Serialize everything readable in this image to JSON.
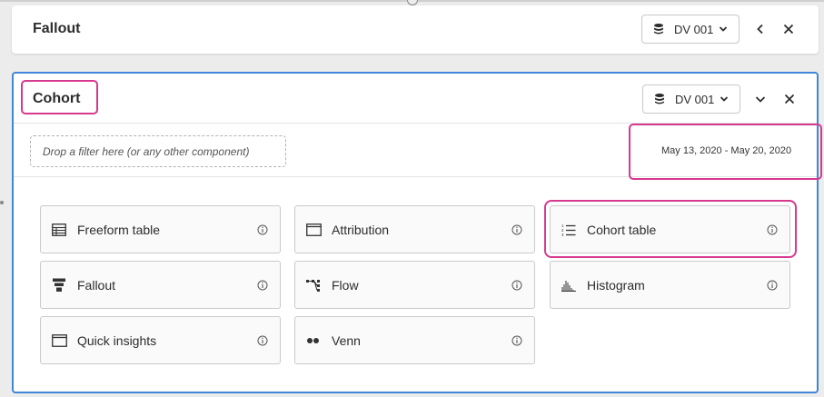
{
  "panels": {
    "fallout": {
      "title": "Fallout",
      "datasource_label": "DV 001"
    },
    "cohort": {
      "title": "Cohort",
      "datasource_label": "DV 001",
      "filter_placeholder": "Drop a filter here (or any other component)",
      "date_range": "May 13, 2020 - May 20, 2020"
    }
  },
  "visualizations": [
    {
      "label": "Freeform table",
      "icon": "table-icon"
    },
    {
      "label": "Attribution",
      "icon": "window-icon"
    },
    {
      "label": "Cohort table",
      "icon": "numbered-list-icon"
    },
    {
      "label": "Fallout",
      "icon": "funnel-icon"
    },
    {
      "label": "Flow",
      "icon": "flow-icon"
    },
    {
      "label": "Histogram",
      "icon": "histogram-icon"
    },
    {
      "label": "Quick insights",
      "icon": "window-icon"
    },
    {
      "label": "Venn",
      "icon": "venn-icon"
    }
  ],
  "colors": {
    "annotation": "#d6398e",
    "active_panel_border": "#3f86d6"
  }
}
